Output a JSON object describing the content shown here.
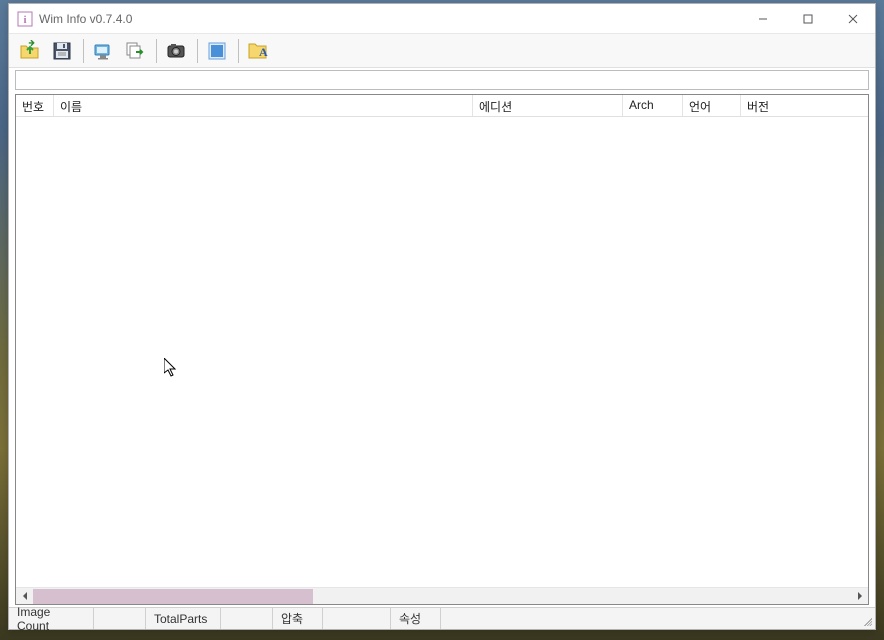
{
  "window": {
    "title": "Wim Info v0.7.4.0"
  },
  "toolbar": {
    "buttons": [
      {
        "name": "open-file-button"
      },
      {
        "name": "save-button"
      },
      {
        "name": "mount-button"
      },
      {
        "name": "export-button"
      },
      {
        "name": "capture-button"
      },
      {
        "name": "view-button"
      },
      {
        "name": "font-button"
      }
    ]
  },
  "columns": {
    "number": "번호",
    "name": "이름",
    "edition": "에디션",
    "arch": "Arch",
    "language": "언어",
    "version": "버전"
  },
  "statusbar": {
    "image_count_label": "Image Count",
    "total_parts_label": "TotalParts",
    "compression_label": "압축",
    "attributes_label": "속성"
  }
}
